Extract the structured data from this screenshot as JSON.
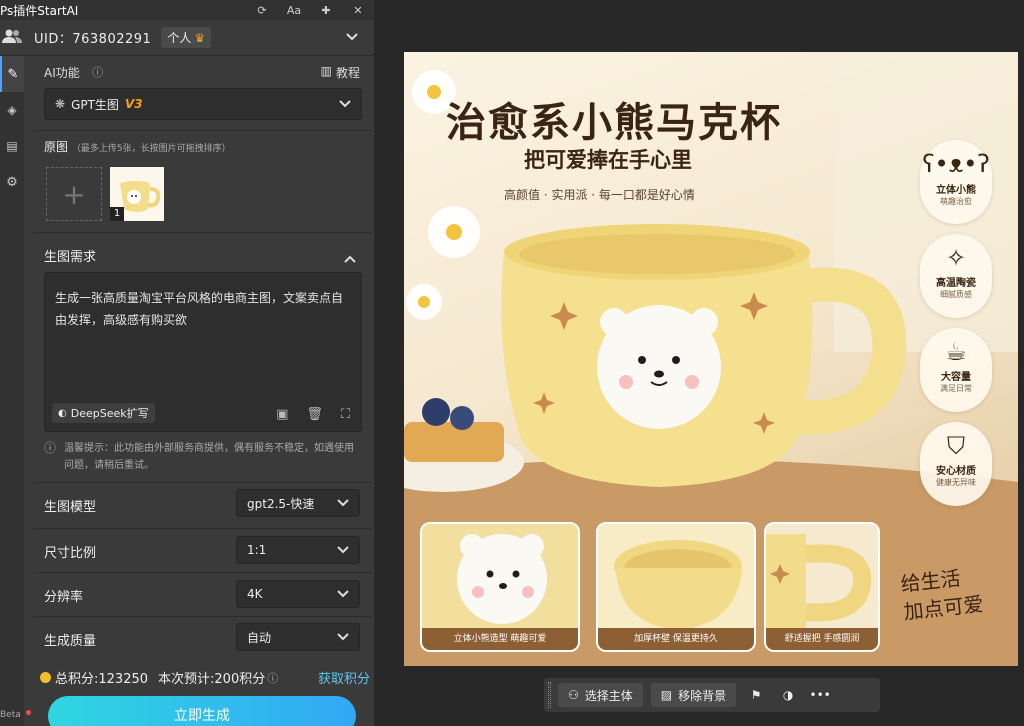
{
  "titlebar": {
    "title": "Ps插件StartAI"
  },
  "account": {
    "uid_label": "UID：763802291",
    "plan": "个人"
  },
  "ai_function": {
    "label": "AI功能",
    "help_link": "教程",
    "selected": "GPT生图",
    "version": "V3"
  },
  "source_images": {
    "label": "原图",
    "hint": "（最多上传5张，长按图片可拖拽排序）",
    "thumb_index": "1"
  },
  "prompt": {
    "label": "生图需求",
    "text": "生成一张高质量淘宝平台风格的电商主图，文案卖点自由发挥，高级感有购买欲",
    "expand_button": "DeepSeek扩写"
  },
  "tip": {
    "text": "温馨提示：此功能由外部服务商提供，偶有服务不稳定，如遇使用问题，请稍后重试。"
  },
  "params": {
    "model": {
      "label": "生图模型",
      "value": "gpt2.5-快速"
    },
    "ratio": {
      "label": "尺寸比例",
      "value": "1:1"
    },
    "resolution": {
      "label": "分辨率",
      "value": "4K"
    },
    "quality": {
      "label": "生成质量",
      "value": "自动"
    }
  },
  "footer": {
    "total_points": "总积分:123250",
    "estimate": "本次预计:200积分",
    "get_points": "获取积分",
    "generate": "立即生成",
    "beta": "Beta"
  },
  "canvas": {
    "title": "治愈系小熊马克杯",
    "subtitle": "把可爱捧在手心里",
    "tagline": "高颜值 · 实用派 · 每一口都是好心情",
    "features": [
      {
        "title": "立体小熊",
        "sub": "萌趣治愈"
      },
      {
        "title": "高温陶瓷",
        "sub": "细腻质感"
      },
      {
        "title": "大容量",
        "sub": "满足日常"
      },
      {
        "title": "安心材质",
        "sub": "健康无异味"
      }
    ],
    "details": [
      {
        "caption": "立体小熊造型  萌趣可爱"
      },
      {
        "caption": "加厚杯壁  保温更持久"
      },
      {
        "caption": "舒适握把  手感圆润"
      }
    ],
    "slogan_line1": "给生活",
    "slogan_line2": "加点可爱"
  },
  "toolbar": {
    "select_subject": "选择主体",
    "remove_bg": "移除背景"
  },
  "colors": {
    "accent": "#32a8f5",
    "points_link": "#5cc8f0",
    "version": "#f3a21c",
    "caption_bg": "#8d5f35"
  }
}
